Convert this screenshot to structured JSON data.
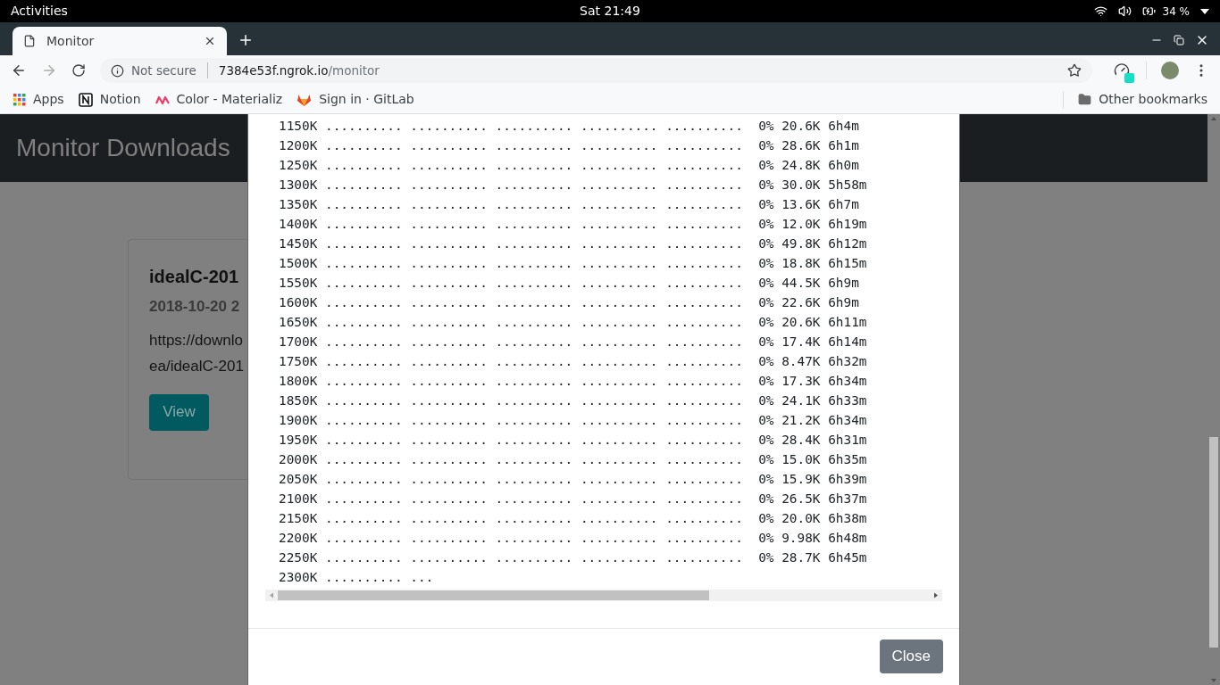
{
  "top_bar": {
    "activities": "Activities",
    "clock": "Sat 21:49",
    "battery": "34 %"
  },
  "browser": {
    "tabs": [
      {
        "title": "Monitor",
        "selected": true
      }
    ],
    "navigation": {
      "back_disabled": false,
      "forward_disabled": true
    },
    "address": {
      "security": "Not secure",
      "host": "7384e53f.ngrok.io",
      "path": "/monitor"
    },
    "bookmarks": [
      {
        "kind": "apps",
        "label": "Apps"
      },
      {
        "kind": "notion",
        "label": "Notion"
      },
      {
        "kind": "materialize",
        "label": "Color - Materializ"
      },
      {
        "kind": "gitlab",
        "label": "Sign in · GitLab"
      }
    ],
    "other_bookmarks": "Other bookmarks"
  },
  "page": {
    "navbar_title": "Monitor Downloads",
    "card": {
      "title": "idealC-201",
      "date": "2018-10-20 2",
      "url_lines": [
        "https://downlo",
        "ea/idealC-201"
      ],
      "button": "View"
    }
  },
  "modal": {
    "log_lines": [
      "1150K .......... .......... .......... .......... ..........  0% 20.6K 6h4m",
      "1200K .......... .......... .......... .......... ..........  0% 28.6K 6h1m",
      "1250K .......... .......... .......... .......... ..........  0% 24.8K 6h0m",
      "1300K .......... .......... .......... .......... ..........  0% 30.0K 5h58m",
      "1350K .......... .......... .......... .......... ..........  0% 13.6K 6h7m",
      "1400K .......... .......... .......... .......... ..........  0% 12.0K 6h19m",
      "1450K .......... .......... .......... .......... ..........  0% 49.8K 6h12m",
      "1500K .......... .......... .......... .......... ..........  0% 18.8K 6h15m",
      "1550K .......... .......... .......... .......... ..........  0% 44.5K 6h9m",
      "1600K .......... .......... .......... .......... ..........  0% 22.6K 6h9m",
      "1650K .......... .......... .......... .......... ..........  0% 20.6K 6h11m",
      "1700K .......... .......... .......... .......... ..........  0% 17.4K 6h14m",
      "1750K .......... .......... .......... .......... ..........  0% 8.47K 6h32m",
      "1800K .......... .......... .......... .......... ..........  0% 17.3K 6h34m",
      "1850K .......... .......... .......... .......... ..........  0% 24.1K 6h33m",
      "1900K .......... .......... .......... .......... ..........  0% 21.2K 6h34m",
      "1950K .......... .......... .......... .......... ..........  0% 28.4K 6h31m",
      "2000K .......... .......... .......... .......... ..........  0% 15.0K 6h35m",
      "2050K .......... .......... .......... .......... ..........  0% 15.9K 6h39m",
      "2100K .......... .......... .......... .......... ..........  0% 26.5K 6h37m",
      "2150K .......... .......... .......... .......... ..........  0% 20.0K 6h38m",
      "2200K .......... .......... .......... .......... ..........  0% 9.98K 6h48m",
      "2250K .......... .......... .......... .......... ..........  0% 28.7K 6h45m",
      "2300K .......... ..."
    ],
    "close_button": "Close"
  }
}
